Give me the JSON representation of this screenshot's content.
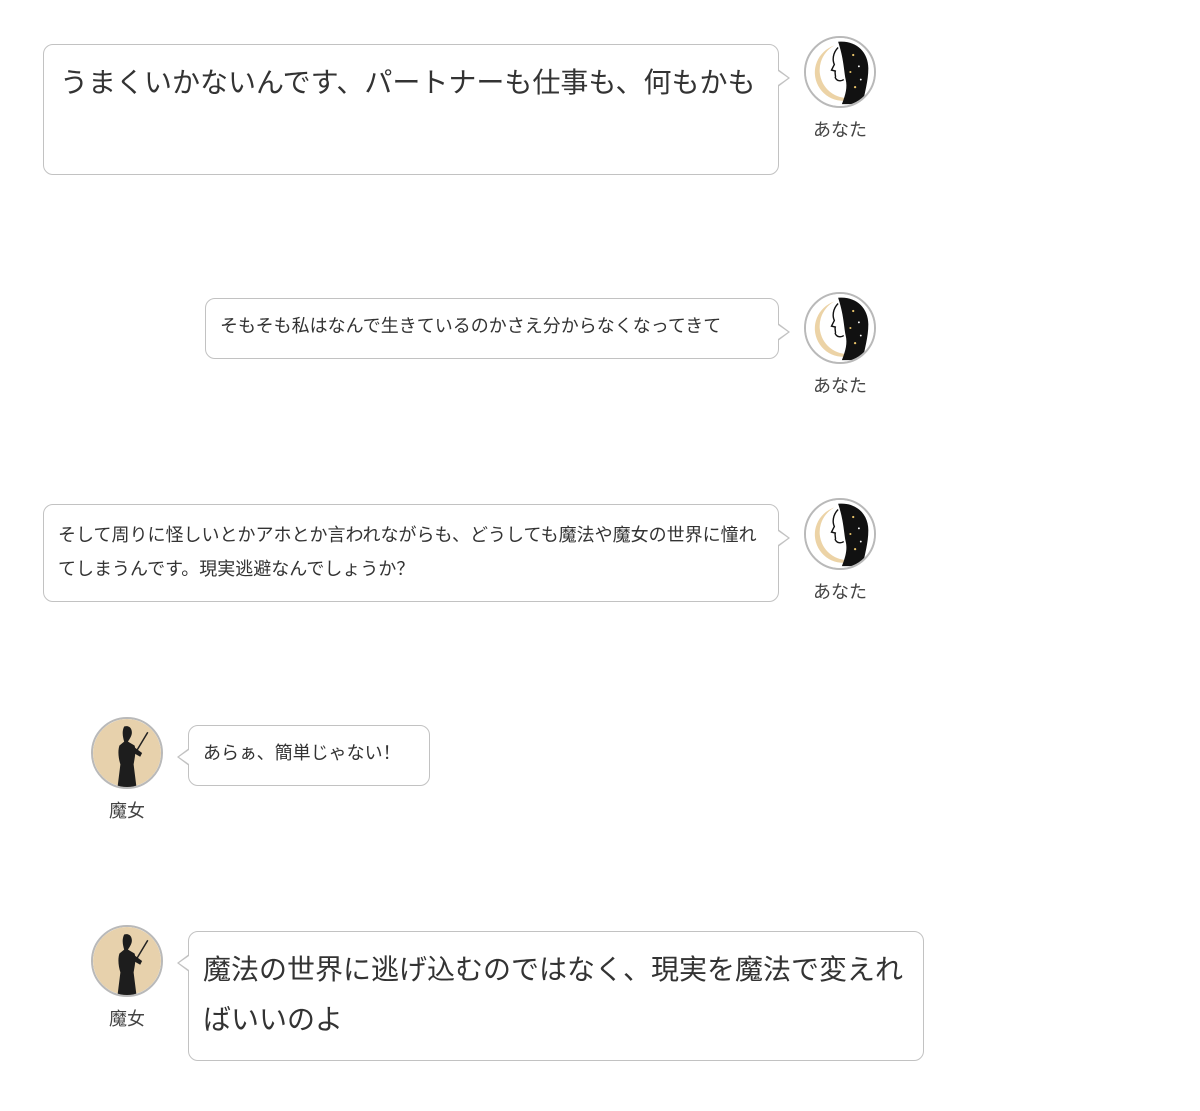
{
  "speakers": {
    "user": {
      "name": "あなた",
      "icon": "woman-profile-moon-icon"
    },
    "witch": {
      "name": "魔女",
      "icon": "witch-silhouette-icon"
    }
  },
  "messages": [
    {
      "speaker": "user",
      "text": "うまくいかないんです、パートナーも仕事も、何もかも"
    },
    {
      "speaker": "user",
      "text": "そもそも私はなんで生きているのかさえ分からなくなってきて"
    },
    {
      "speaker": "user",
      "text": "そして周りに怪しいとかアホとか言われながらも、どうしても魔法や魔女の世界に憧れてしまうんです。現実逃避なんでしょうか？"
    },
    {
      "speaker": "witch",
      "text": "あらぁ、簡単じゃない！"
    },
    {
      "speaker": "witch",
      "text": "魔法の世界に逃げ込むのではなく、現実を魔法で変えればいいのよ"
    }
  ],
  "colors": {
    "bubble_border": "#c2c2c2",
    "text": "#333333",
    "moon": "#ecd3a6",
    "witch_bg": "#e7d1ac"
  }
}
